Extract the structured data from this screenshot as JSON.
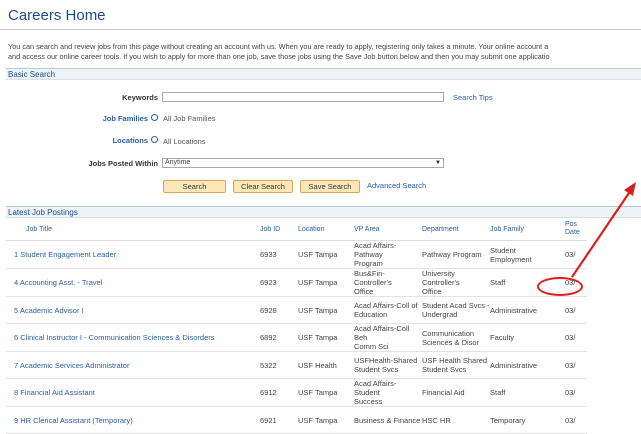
{
  "page": {
    "title": "Careers Home",
    "intro_line1": "You can search and review jobs from this page without creating an account with us. When you are ready to apply, registering only takes a minute. Your online account a",
    "intro_line2": "and access our online career tools. If you wish to apply for more than one job, save those jobs using the Save Job button below and then you may submit one applicatio"
  },
  "basic_search": {
    "section_label": "Basic Search",
    "keywords_label": "Keywords",
    "keywords_value": "",
    "search_tips": "Search Tips",
    "job_families_label": "Job Families",
    "job_families_value": "All Job Families",
    "locations_label": "Locations",
    "locations_value": "All Locations",
    "posted_within_label": "Jobs Posted Within",
    "posted_within_value": "Anytime",
    "search_button": "Search",
    "clear_button": "Clear Search",
    "save_button": "Save Search",
    "advanced_link": "Advanced Search"
  },
  "postings": {
    "section_label": "Latest Job Postings",
    "columns": [
      "Job Title",
      "Job ID",
      "Location",
      "VP Area",
      "Department",
      "Job Family",
      "Pos",
      "Date"
    ],
    "rows": [
      {
        "title": "1 Student Engagement Leader",
        "id": "6933",
        "location": "USF Tampa",
        "vp1": "Acad Affairs-Pathway",
        "vp2": "Program",
        "dept1": "Pathway Program",
        "dept2": "",
        "family1": "Student",
        "family2": "Employment",
        "date": "03/"
      },
      {
        "title": "4 Accounting Asst. - Travel",
        "id": "6923",
        "location": "USF Tampa",
        "vp1": "Bus&Fin-Controller's",
        "vp2": "Office",
        "dept1": "University Controller's",
        "dept2": "Office",
        "family1": "Staff",
        "family2": "",
        "date": "03/"
      },
      {
        "title": "5 Academic Advisor I",
        "id": "6928",
        "location": "USF Tampa",
        "vp1": "Acad Affairs-Coll of",
        "vp2": "Education",
        "dept1": "Student Acad Svcs -",
        "dept2": "Undergrad",
        "family1": "Administrative",
        "family2": "",
        "date": "03/"
      },
      {
        "title": "6 Clinical Instructor I - Communication Sciences & Disorders",
        "id": "6892",
        "location": "USF Tampa",
        "vp1": "Acad Affairs-Coll Beh",
        "vp2": "Comm Sci",
        "dept1": "Communication",
        "dept2": "Sciences & Disor",
        "family1": "Faculty",
        "family2": "",
        "date": "03/"
      },
      {
        "title": "7 Academic Services Administrator",
        "id": "5322",
        "location": "USF Health",
        "vp1": "USFHealth-Shared",
        "vp2": "Student Svcs",
        "dept1": "USF Health Shared",
        "dept2": "Student Svcs",
        "family1": "Administrative",
        "family2": "",
        "date": "03/"
      },
      {
        "title": "8 Financial Aid Assistant",
        "id": "6912",
        "location": "USF Tampa",
        "vp1": "Acad Affairs-Student",
        "vp2": "Success",
        "dept1": "Financial Aid",
        "dept2": "",
        "family1": "Staff",
        "family2": "",
        "date": "03/"
      },
      {
        "title": "9 HR Clerical Assistant (Temporary)",
        "id": "6921",
        "location": "USF Tampa",
        "vp1": "Business & Finance",
        "vp2": "",
        "dept1": "HSC HR",
        "dept2": "",
        "family1": "Temporary",
        "family2": "",
        "date": "03/"
      }
    ]
  },
  "colors": {
    "accent": "#2a5ea6",
    "title": "#1a4d8c",
    "annotation": "#d9201f",
    "button": "#fce7b8"
  }
}
